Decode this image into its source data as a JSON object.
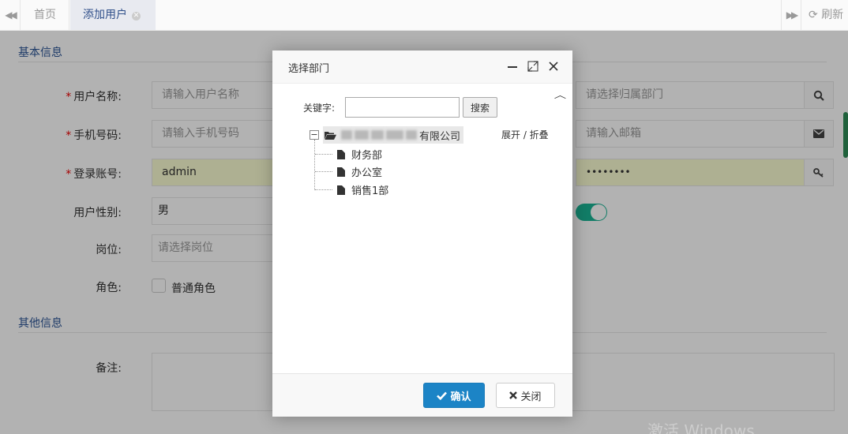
{
  "tabs": {
    "home_label": "首页",
    "active_label": "添加用户",
    "refresh_label": "刷新"
  },
  "form": {
    "section_basic": "基本信息",
    "section_other": "其他信息",
    "username_label": "用户名称:",
    "username_placeholder": "请输入用户名称",
    "dept_placeholder": "请选择归属部门",
    "phone_label": "手机号码:",
    "phone_placeholder": "请输入手机号码",
    "email_placeholder": "请输入邮箱",
    "login_label": "登录账号:",
    "login_value": "admin",
    "password_value": "••••••••",
    "gender_label": "用户性别:",
    "gender_value": "男",
    "post_label": "岗位:",
    "post_placeholder": "请选择岗位",
    "role_label": "角色:",
    "role_option": "普通角色",
    "remark_label": "备注:",
    "required_mark": "*",
    "status_enabled": true
  },
  "dialog": {
    "title": "选择部门",
    "keyword_label": "关键字:",
    "keyword_value": "",
    "search_label": "搜索",
    "expand_collapse": "展开 / 折叠",
    "tree": {
      "toggle": "−",
      "root_suffix": "有限公司",
      "children": [
        "财务部",
        "办公室",
        "销售1部"
      ]
    },
    "ok_label": "确认",
    "close_label": "关闭"
  },
  "watermark": "激活 Windows",
  "colors": {
    "primary_button": "#1c84c6",
    "section_title": "#2c5596",
    "toggle_on": "#1ab394",
    "required": "#e00000",
    "autofill_yellow": "#fafcd2"
  },
  "icons": {
    "tab_left": "double-chevron-left-icon",
    "tab_right": "double-chevron-right-icon",
    "refresh": "refresh-icon",
    "search": "search-icon",
    "email": "envelope-icon",
    "key": "key-icon",
    "minimize": "minimize-icon",
    "maximize": "maximize-icon",
    "close": "close-icon",
    "folder": "folder-open-icon",
    "file": "file-icon",
    "check": "check-icon",
    "times": "times-icon"
  }
}
